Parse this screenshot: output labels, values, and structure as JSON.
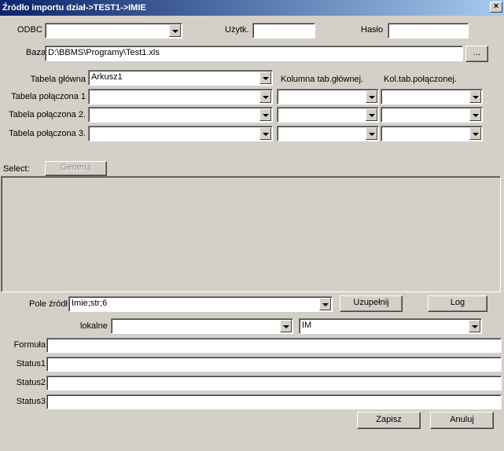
{
  "window": {
    "title": "Źródło importu dział->TEST1->IMIE",
    "close_label": "×"
  },
  "connection": {
    "odbc_label": "ODBC",
    "odbc_value": "",
    "user_label": "Użytk.",
    "user_value": "",
    "password_label": "Hasło",
    "password_value": "",
    "base_label": "Baza",
    "base_value": "D:\\BBMS\\Programy\\Test1.xls",
    "browse_label": "..."
  },
  "tables": {
    "col_header_main": "Kolumna tab.głównej.",
    "col_header_joined": "Kol.tab.połączonej.",
    "rows": [
      {
        "label": "Tabela główna",
        "table": "Arkusz1"
      },
      {
        "label": "Tabela połączona 1",
        "table": "",
        "main_col": "",
        "joined_col": ""
      },
      {
        "label": "Tabela połączona 2.",
        "table": "",
        "main_col": "",
        "joined_col": ""
      },
      {
        "label": "Tabela połączona 3.",
        "table": "",
        "main_col": "",
        "joined_col": ""
      }
    ]
  },
  "select": {
    "label": "Select:",
    "generate_label": "Generuj",
    "text": ""
  },
  "source": {
    "field_label": "Pole źródł",
    "field_value": "Imie;str;6",
    "fill_label": "Uzupełnij",
    "log_label": "Log",
    "local_label": "lokalne",
    "local_value": "",
    "local_target": "IM"
  },
  "details": [
    {
      "label": "Formuła",
      "value": ""
    },
    {
      "label": "Status1",
      "value": ""
    },
    {
      "label": "Status2",
      "value": ""
    },
    {
      "label": "Status3",
      "value": ""
    }
  ],
  "actions": {
    "save_label": "Zapisz",
    "cancel_label": "Anuluj"
  }
}
